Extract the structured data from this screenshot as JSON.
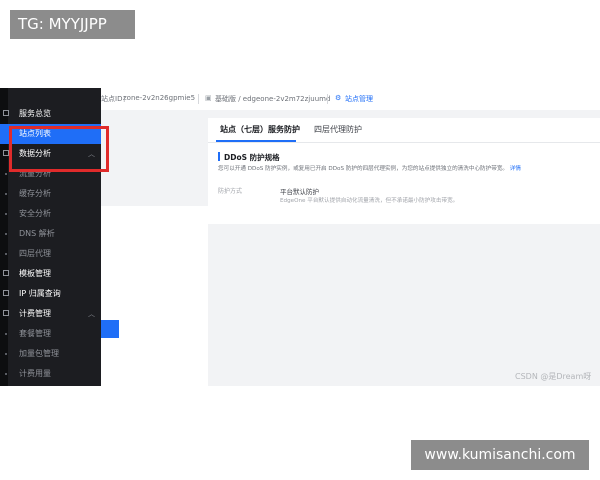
{
  "tg_label": "TG: MYYJJPP",
  "topbar": {
    "zone_label": "站点ID：",
    "zone_id": "zone-2v2n26gpmie5",
    "plan": "基础版 / edgeone-2v2m72zjuumd",
    "manage_label": "站点管理"
  },
  "sidebar": {
    "items": [
      {
        "label": "服务总览",
        "type": "group"
      },
      {
        "label": "站点列表",
        "type": "item",
        "active": true
      },
      {
        "label": "数据分析",
        "type": "group",
        "expanded": true
      },
      {
        "label": "流量分析",
        "type": "sub"
      },
      {
        "label": "缓存分析",
        "type": "sub"
      },
      {
        "label": "安全分析",
        "type": "sub"
      },
      {
        "label": "DNS 解析",
        "type": "sub"
      },
      {
        "label": "四层代理",
        "type": "sub"
      },
      {
        "label": "模板管理",
        "type": "group"
      },
      {
        "label": "IP 归属查询",
        "type": "group"
      },
      {
        "label": "计费管理",
        "type": "group",
        "expanded": true
      },
      {
        "label": "套餐管理",
        "type": "sub"
      },
      {
        "label": "加量包管理",
        "type": "sub"
      },
      {
        "label": "计费用量",
        "type": "sub"
      }
    ]
  },
  "main": {
    "tabs": [
      {
        "label": "站点（七层）服务防护",
        "active": true
      },
      {
        "label": "四层代理防护",
        "active": false
      }
    ],
    "section_title": "DDoS 防护规格",
    "section_desc": "您可以开通 DDoS 防护实例，或复用已开启 DDoS 防护的四层代理实例，为您的站点提供独立的清洗中心防护带宽。",
    "section_link": "详情",
    "row_label": "防护方式",
    "row_value": "平台默认防护",
    "row_sub": "EdgeOne 平台默认提供自动化流量清洗，但不承诺最小防护攻击带宽。"
  },
  "watermark": "CSDN @是Dream呀",
  "site_label": "www.kumisanchi.com",
  "colors": {
    "accent": "#1f6ef7",
    "sidebar_bg": "#1c1d21",
    "highlight": "#e02b2b"
  }
}
